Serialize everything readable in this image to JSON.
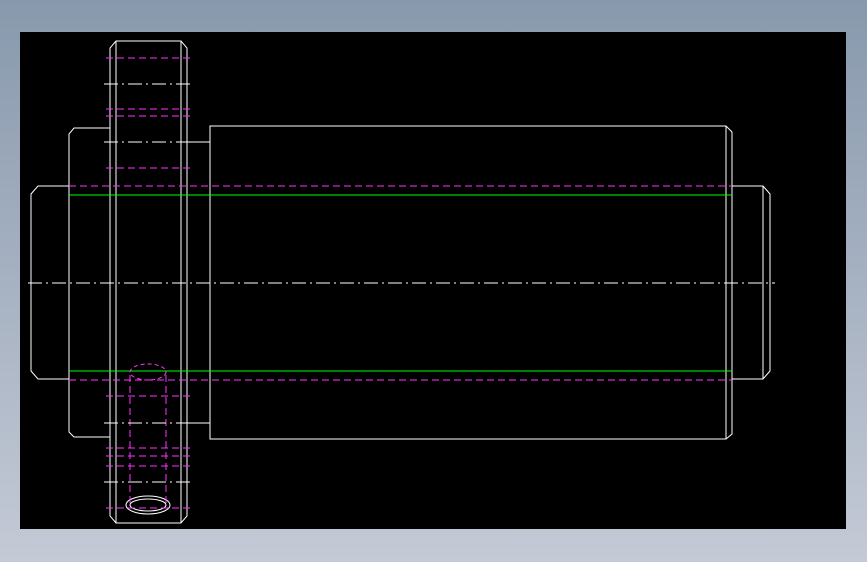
{
  "colors": {
    "background_top": "#8899AD",
    "background_bottom": "#C4CAD6",
    "canvas": "#000000",
    "outline": "#FFFFFF",
    "hidden_line": "#FF33FF",
    "thread_line": "#00FF00",
    "center_line": "#FFFFFF"
  },
  "drawing": {
    "view": "front view",
    "line_types": [
      "outline",
      "hidden-line",
      "thread-root-line",
      "center-line"
    ]
  }
}
